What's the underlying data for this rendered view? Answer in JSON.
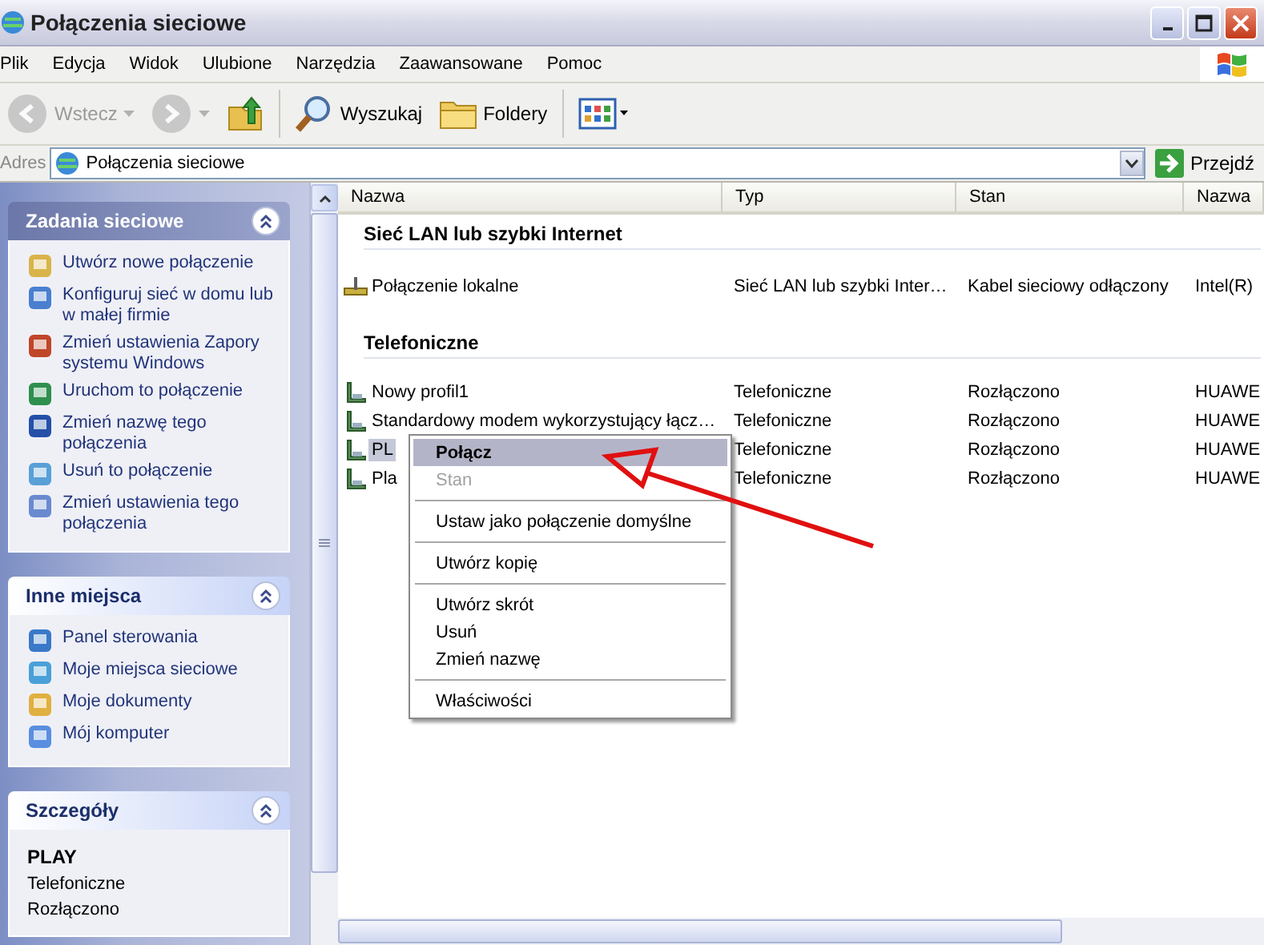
{
  "window": {
    "title": "Połączenia sieciowe"
  },
  "menu_bar": [
    "Plik",
    "Edycja",
    "Widok",
    "Ulubione",
    "Narzędzia",
    "Zaawansowane",
    "Pomoc"
  ],
  "toolbar": [
    {
      "kind": "back",
      "label": "Wstecz",
      "disabled": true
    },
    {
      "kind": "forward",
      "disabled": true
    },
    {
      "kind": "up"
    },
    {
      "kind": "search",
      "label": "Wyszukaj"
    },
    {
      "kind": "folders",
      "label": "Foldery"
    },
    {
      "kind": "views"
    }
  ],
  "address_bar": {
    "label": "Adres",
    "value": "Połączenia sieciowe",
    "go_label": "Przejdź"
  },
  "task_panels": [
    {
      "kind": "links",
      "title": "Zadania sieciowe",
      "expanded": true,
      "items": [
        "Utwórz nowe połączenie",
        "Konfiguruj sieć w domu lub w małej firmie",
        "Zmień ustawienia Zapory systemu Windows",
        "Uruchom to połączenie",
        "Zmień nazwę tego połączenia",
        "Usuń to połączenie",
        "Zmień ustawienia tego połączenia"
      ]
    },
    {
      "kind": "links",
      "title": "Inne miejsca",
      "expanded": true,
      "items": [
        "Panel sterowania",
        "Moje miejsca sieciowe",
        "Moje dokumenty",
        "Mój komputer"
      ]
    },
    {
      "kind": "details",
      "title": "Szczegóły",
      "expanded": true,
      "name": "PLAY",
      "lines": [
        "Telefoniczne",
        "Rozłączono"
      ]
    }
  ],
  "columns": [
    "Nazwa",
    "Typ",
    "Stan",
    "Nazwa"
  ],
  "groups": [
    {
      "title": "Sieć LAN lub szybki Internet",
      "rows": [
        {
          "kind": "lan",
          "selected": false,
          "cells": [
            "Połączenie lokalne",
            "Sieć LAN lub szybki Inter…",
            "Kabel sieciowy odłączony",
            "Intel(R)"
          ]
        }
      ]
    },
    {
      "title": "Telefoniczne",
      "rows": [
        {
          "kind": "dialup",
          "selected": false,
          "cells": [
            "Nowy profil1",
            "Telefoniczne",
            "Rozłączono",
            "HUAWE"
          ]
        },
        {
          "kind": "dialup",
          "selected": false,
          "cells": [
            "Standardowy modem wykorzystujący łącz…",
            "Telefoniczne",
            "Rozłączono",
            "HUAWE"
          ]
        },
        {
          "kind": "dialup",
          "selected": true,
          "cells": [
            "PL",
            "Telefoniczne",
            "Rozłączono",
            "HUAWE"
          ]
        },
        {
          "kind": "dialup",
          "selected": false,
          "cells": [
            "Pla",
            "Telefoniczne",
            "Rozłączono",
            "HUAWE"
          ]
        }
      ]
    }
  ],
  "context_menu": [
    {
      "kind": "item",
      "label": "Połącz",
      "default": true,
      "selected": true,
      "disabled": false
    },
    {
      "kind": "item",
      "label": "Stan",
      "default": false,
      "selected": false,
      "disabled": true
    },
    {
      "kind": "separator"
    },
    {
      "kind": "item",
      "label": "Ustaw jako połączenie domyślne",
      "default": false,
      "selected": false,
      "disabled": false
    },
    {
      "kind": "separator"
    },
    {
      "kind": "item",
      "label": "Utwórz kopię",
      "default": false,
      "selected": false,
      "disabled": false
    },
    {
      "kind": "separator"
    },
    {
      "kind": "item",
      "label": "Utwórz skrót",
      "default": false,
      "selected": false,
      "disabled": false
    },
    {
      "kind": "item",
      "label": "Usuń",
      "default": false,
      "selected": false,
      "disabled": false
    },
    {
      "kind": "item",
      "label": "Zmień nazwę",
      "default": false,
      "selected": false,
      "disabled": false
    },
    {
      "kind": "separator"
    },
    {
      "kind": "item",
      "label": "Właściwości",
      "default": false,
      "selected": false,
      "disabled": false
    }
  ]
}
